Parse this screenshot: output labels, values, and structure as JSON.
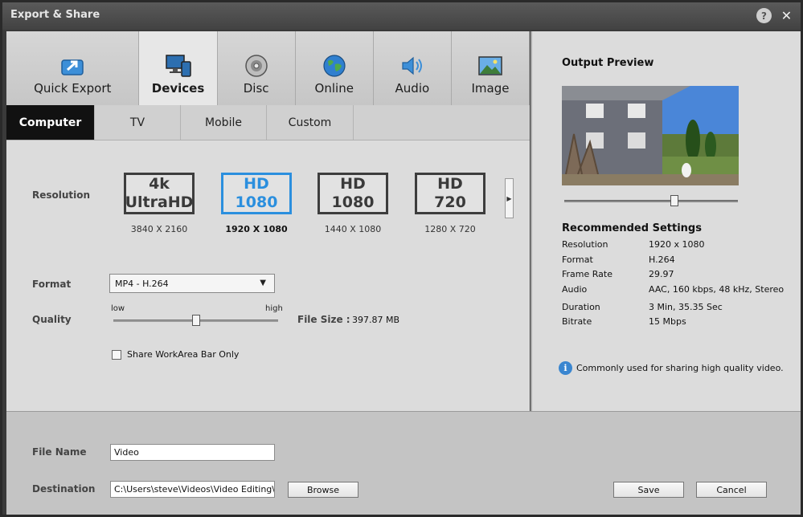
{
  "window": {
    "title": "Export & Share"
  },
  "category_tabs": [
    {
      "label": "Quick Export",
      "icon": "quick-export-icon"
    },
    {
      "label": "Devices",
      "icon": "devices-icon",
      "active": true
    },
    {
      "label": "Disc",
      "icon": "disc-icon"
    },
    {
      "label": "Online",
      "icon": "globe-icon"
    },
    {
      "label": "Audio",
      "icon": "speaker-icon"
    },
    {
      "label": "Image",
      "icon": "image-icon"
    }
  ],
  "sub_tabs": [
    {
      "label": "Computer",
      "active": true
    },
    {
      "label": "TV"
    },
    {
      "label": "Mobile"
    },
    {
      "label": "Custom"
    }
  ],
  "resolution": {
    "label": "Resolution",
    "options": [
      {
        "line1": "4k",
        "line2": "UltraHD",
        "size": "3840 X 2160"
      },
      {
        "line1": "HD",
        "line2": "1080",
        "size": "1920 X 1080",
        "selected": true
      },
      {
        "line1": "HD",
        "line2": "1080",
        "size": "1440 X 1080"
      },
      {
        "line1": "HD",
        "line2": "720",
        "size": "1280 X 720"
      }
    ]
  },
  "format": {
    "label": "Format",
    "value": "MP4 - H.264"
  },
  "quality": {
    "label": "Quality",
    "low": "low",
    "high": "high",
    "level": 0.5
  },
  "file_size": {
    "label": "File Size :",
    "value": "397.87 MB"
  },
  "share_workarea": {
    "label": "Share WorkArea Bar Only",
    "checked": false
  },
  "output_preview": {
    "title": "Output Preview",
    "position": 0.65
  },
  "recommended": {
    "title": "Recommended Settings",
    "rows": [
      {
        "key": "Resolution",
        "value": "1920 x 1080"
      },
      {
        "key": "Format",
        "value": "H.264"
      },
      {
        "key": "Frame Rate",
        "value": "29.97"
      },
      {
        "key": "Audio",
        "value": "AAC, 160 kbps, 48 kHz, Stereo"
      },
      {
        "key": "Duration",
        "value": "3 Min, 35.35 Sec"
      },
      {
        "key": "Bitrate",
        "value": "15 Mbps"
      }
    ],
    "note": "Commonly used for sharing high quality video."
  },
  "file_name": {
    "label": "File Name",
    "value": "Video"
  },
  "destination": {
    "label": "Destination",
    "value": "C:\\Users\\steve\\Videos\\Video Editing\\20"
  },
  "buttons": {
    "browse": "Browse",
    "save": "Save",
    "cancel": "Cancel"
  },
  "colors": {
    "accent": "#2b8fde",
    "active_tab": "#111111"
  }
}
